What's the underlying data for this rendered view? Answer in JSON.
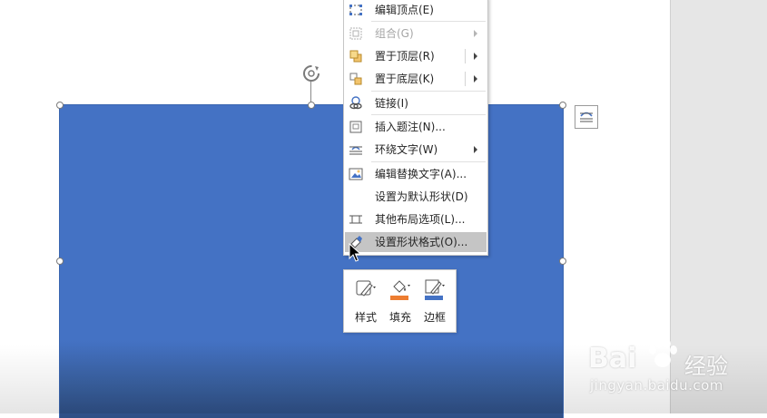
{
  "context_menu": {
    "items": [
      {
        "label": "编辑顶点(E)",
        "icon": "edit-points-icon",
        "enabled": true,
        "submenu": false
      },
      {
        "label": "组合(G)",
        "icon": "group-icon",
        "enabled": false,
        "submenu": true
      },
      {
        "label": "置于顶层(R)",
        "icon": "bring-to-front-icon",
        "enabled": true,
        "submenu": true
      },
      {
        "label": "置于底层(K)",
        "icon": "send-to-back-icon",
        "enabled": true,
        "submenu": true
      },
      {
        "label": "链接(I)",
        "icon": "link-icon",
        "enabled": true,
        "submenu": false
      },
      {
        "label": "插入题注(N)...",
        "icon": "insert-caption-icon",
        "enabled": true,
        "submenu": false
      },
      {
        "label": "环绕文字(W)",
        "icon": "wrap-text-icon",
        "enabled": true,
        "submenu": true
      },
      {
        "label": "编辑替换文字(A)...",
        "icon": "alt-text-icon",
        "enabled": true,
        "submenu": false
      },
      {
        "label": "设置为默认形状(D)",
        "icon": "",
        "enabled": true,
        "submenu": false
      },
      {
        "label": "其他布局选项(L)...",
        "icon": "layout-options-icon",
        "enabled": true,
        "submenu": false
      },
      {
        "label": "设置形状格式(O)...",
        "icon": "format-shape-icon",
        "enabled": true,
        "submenu": false,
        "hovered": true
      }
    ]
  },
  "mini_toolbar": {
    "style_label": "样式",
    "fill_label": "填充",
    "border_label": "边框"
  },
  "watermark": {
    "brand": "Bai",
    "brand_suffix": "经验",
    "url": "jingyan.baidu.com"
  },
  "colors": {
    "shape_fill": "#4472c4",
    "fill_accent": "#ed7d31",
    "border_accent": "#4472c4",
    "menu_hover": "#c5c5c5"
  }
}
